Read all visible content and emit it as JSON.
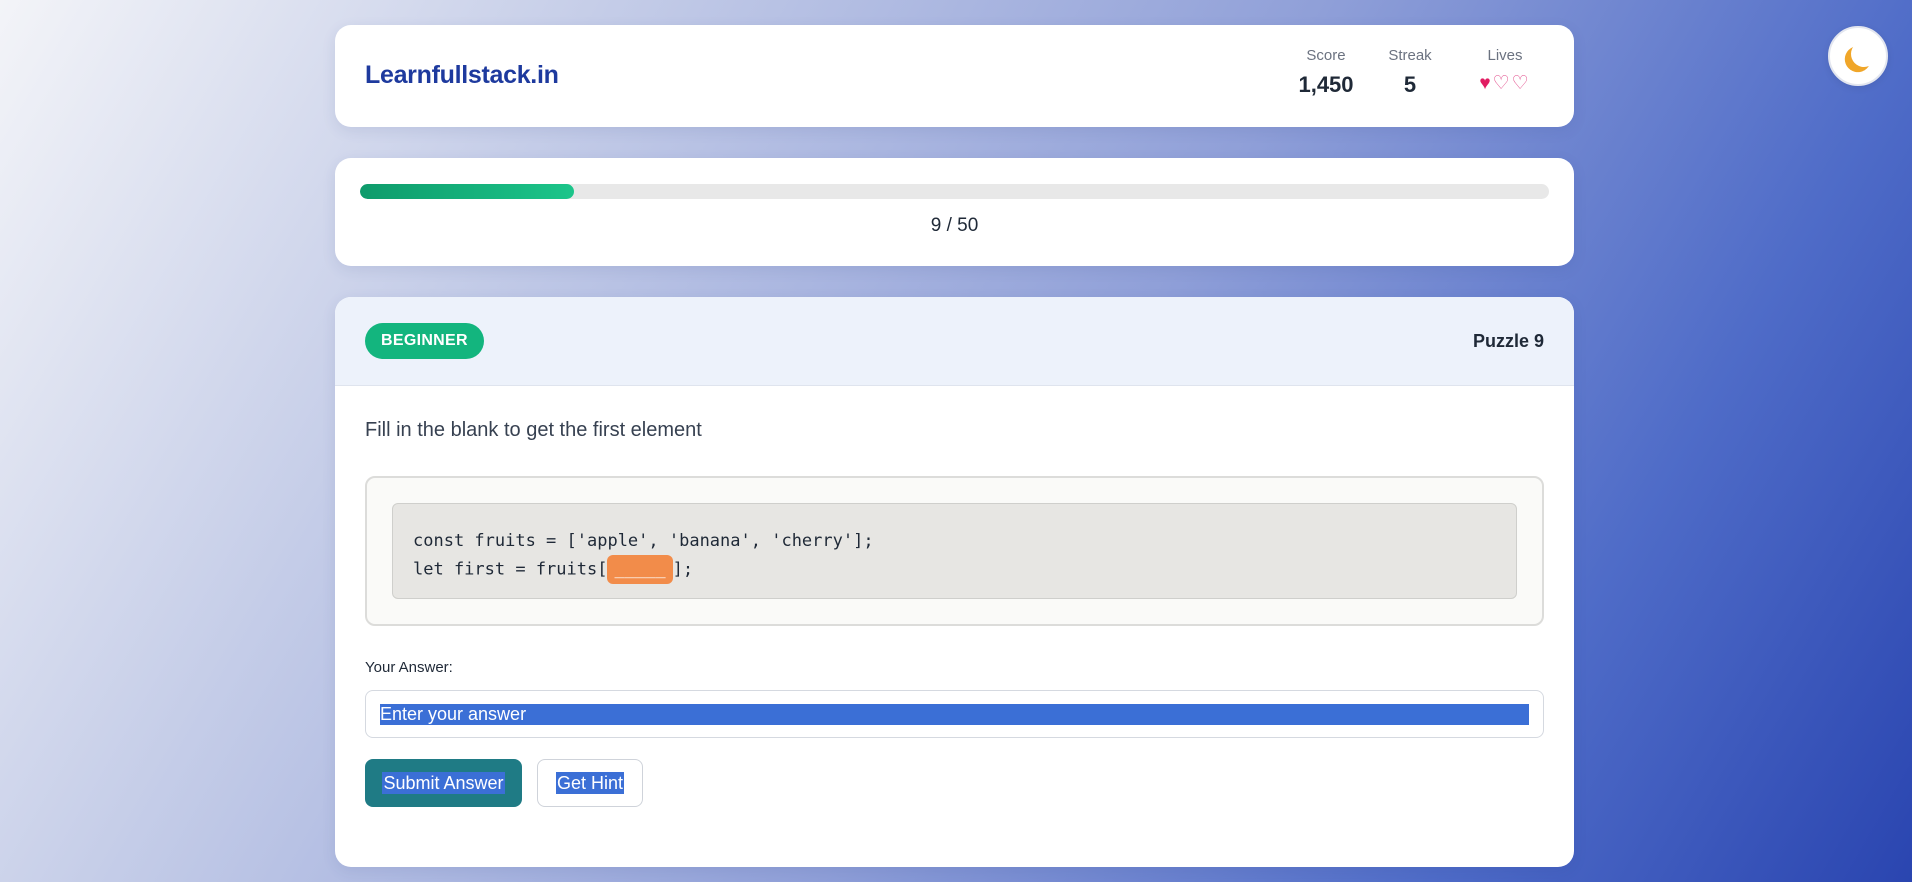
{
  "header": {
    "brand": "Learnfullstack.in",
    "score_label": "Score",
    "score_value": "1,450",
    "streak_label": "Streak",
    "streak_value": "5",
    "lives_label": "Lives",
    "lives": {
      "total": 3,
      "remaining": 1,
      "icons": [
        "heart-icon",
        "broken-heart-icon",
        "broken-heart-icon"
      ]
    }
  },
  "theme_toggle": {
    "icon": "moon-icon"
  },
  "progress": {
    "current": 9,
    "total": 50,
    "text": "9 / 50"
  },
  "puzzle": {
    "difficulty": "BEGINNER",
    "number_label": "Puzzle 9",
    "prompt": "Fill in the blank to get the first element",
    "code_line1": "const fruits = ['apple', 'banana', 'cherry'];",
    "code_line2_prefix": "let first = fruits[",
    "code_blank": "_____",
    "code_line2_suffix": "];",
    "answer_label": "Your Answer:",
    "answer_placeholder": "Enter your answer",
    "answer_value": "",
    "submit_label": "Submit Answer",
    "hint_label": "Get Hint"
  },
  "colors": {
    "brand": "#1e3a9e",
    "badge": "#13b57e",
    "progress_fill": "#1cc58a",
    "code_blank": "#f28c4a",
    "submit_button": "#1f7b85"
  }
}
